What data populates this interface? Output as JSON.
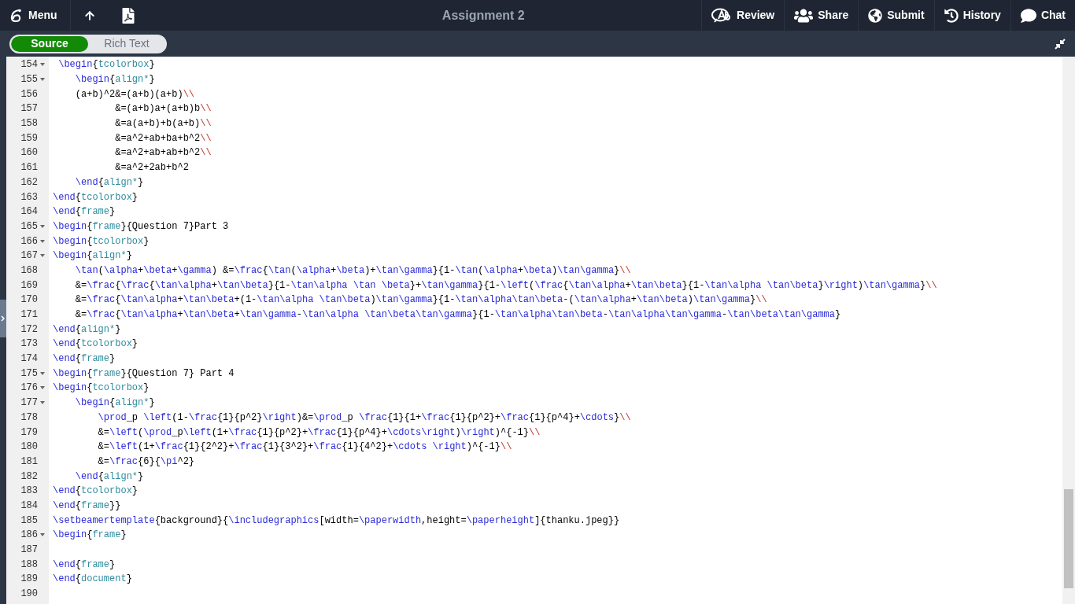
{
  "toolbar": {
    "left": [
      {
        "kind": "menu",
        "label": "Menu"
      },
      {
        "kind": "upload"
      },
      {
        "kind": "pdf"
      }
    ],
    "title": "Assignment 2",
    "right": [
      {
        "kind": "review",
        "label": "Review"
      },
      {
        "kind": "share",
        "label": "Share"
      },
      {
        "kind": "submit",
        "label": "Submit"
      },
      {
        "kind": "history",
        "label": "History"
      },
      {
        "kind": "chat",
        "label": "Chat"
      }
    ]
  },
  "mode_toggle": [
    {
      "label": "Source",
      "selected": true
    },
    {
      "label": "Rich Text",
      "selected": false
    }
  ],
  "editor": {
    "lines": [
      {
        "number": "154",
        "text": " \\begin{tcolorbox}",
        "foldable": true
      },
      {
        "number": "155",
        "text": "    \\begin{align*}",
        "foldable": true
      },
      {
        "number": "156",
        "text": "    (a+b)^2&=(a+b)(a+b)\\\\",
        "foldable": false
      },
      {
        "number": "157",
        "text": "           &=(a+b)a+(a+b)b\\\\",
        "foldable": false
      },
      {
        "number": "158",
        "text": "           &=a(a+b)+b(a+b)\\\\",
        "foldable": false
      },
      {
        "number": "159",
        "text": "           &=a^2+ab+ba+b^2\\\\",
        "foldable": false
      },
      {
        "number": "160",
        "text": "           &=a^2+ab+ab+b^2\\\\",
        "foldable": false
      },
      {
        "number": "161",
        "text": "           &=a^2+2ab+b^2",
        "foldable": false
      },
      {
        "number": "162",
        "text": "    \\end{align*}",
        "foldable": false
      },
      {
        "number": "163",
        "text": "\\end{tcolorbox}",
        "foldable": false
      },
      {
        "number": "164",
        "text": "\\end{frame}",
        "foldable": false
      },
      {
        "number": "165",
        "text": "\\begin{frame}{Question 7}Part 3",
        "foldable": true
      },
      {
        "number": "166",
        "text": "\\begin{tcolorbox}",
        "foldable": true
      },
      {
        "number": "167",
        "text": "\\begin{align*}",
        "foldable": true
      },
      {
        "number": "168",
        "text": "    \\tan(\\alpha+\\beta+\\gamma) &=\\frac{\\tan(\\alpha+\\beta)+\\tan\\gamma}{1-\\tan(\\alpha+\\beta)\\tan\\gamma}\\\\",
        "foldable": false
      },
      {
        "number": "169",
        "text": "    &=\\frac{\\frac{\\tan\\alpha+\\tan\\beta}{1-\\tan\\alpha \\tan \\beta}+\\tan\\gamma}{1-\\left(\\frac{\\tan\\alpha+\\tan\\beta}{1-\\tan\\alpha \\tan\\beta}\\right)\\tan\\gamma}\\\\",
        "foldable": false
      },
      {
        "number": "170",
        "text": "    &=\\frac{\\tan\\alpha+\\tan\\beta+(1-\\tan\\alpha \\tan\\beta)\\tan\\gamma}{1-\\tan\\alpha\\tan\\beta-(\\tan\\alpha+\\tan\\beta)\\tan\\gamma}\\\\",
        "foldable": false
      },
      {
        "number": "171",
        "text": "    &=\\frac{\\tan\\alpha+\\tan\\beta+\\tan\\gamma-\\tan\\alpha \\tan\\beta\\tan\\gamma}{1-\\tan\\alpha\\tan\\beta-\\tan\\alpha\\tan\\gamma-\\tan\\beta\\tan\\gamma}",
        "foldable": false
      },
      {
        "number": "172",
        "text": "\\end{align*}",
        "foldable": false
      },
      {
        "number": "173",
        "text": "\\end{tcolorbox}",
        "foldable": false
      },
      {
        "number": "174",
        "text": "\\end{frame}",
        "foldable": false
      },
      {
        "number": "175",
        "text": "\\begin{frame}{Question 7} Part 4",
        "foldable": true
      },
      {
        "number": "176",
        "text": "\\begin{tcolorbox}",
        "foldable": true
      },
      {
        "number": "177",
        "text": "    \\begin{align*}",
        "foldable": true
      },
      {
        "number": "178",
        "text": "        \\prod_p \\left(1-\\frac{1}{p^2}\\right)&=\\prod_p \\frac{1}{1+\\frac{1}{p^2}+\\frac{1}{p^4}+\\cdots}\\\\",
        "foldable": false
      },
      {
        "number": "179",
        "text": "        &=\\left(\\prod_p\\left(1+\\frac{1}{p^2}+\\frac{1}{p^4}+\\cdots\\right)\\right)^{-1}\\\\",
        "foldable": false
      },
      {
        "number": "180",
        "text": "        &=\\left(1+\\frac{1}{2^2}+\\frac{1}{3^2}+\\frac{1}{4^2}+\\cdots \\right)^{-1}\\\\",
        "foldable": false
      },
      {
        "number": "181",
        "text": "        &=\\frac{6}{\\pi^2}",
        "foldable": false
      },
      {
        "number": "182",
        "text": "    \\end{align*}",
        "foldable": false
      },
      {
        "number": "183",
        "text": "\\end{tcolorbox}",
        "foldable": false
      },
      {
        "number": "184",
        "text": "\\end{frame}}",
        "foldable": false
      },
      {
        "number": "185",
        "text": "\\setbeamertemplate{background}{\\includegraphics[width=\\paperwidth,height=\\paperheight]{thanku.jpeg}}",
        "foldable": false
      },
      {
        "number": "186",
        "text": "\\begin{frame}",
        "foldable": true
      },
      {
        "number": "187",
        "foldable": false
      },
      {
        "number": "188",
        "text": "\\end{frame}",
        "foldable": false
      },
      {
        "number": "189",
        "text": "\\end{document}",
        "foldable": false
      },
      {
        "number": "190",
        "foldable": false
      }
    ]
  }
}
